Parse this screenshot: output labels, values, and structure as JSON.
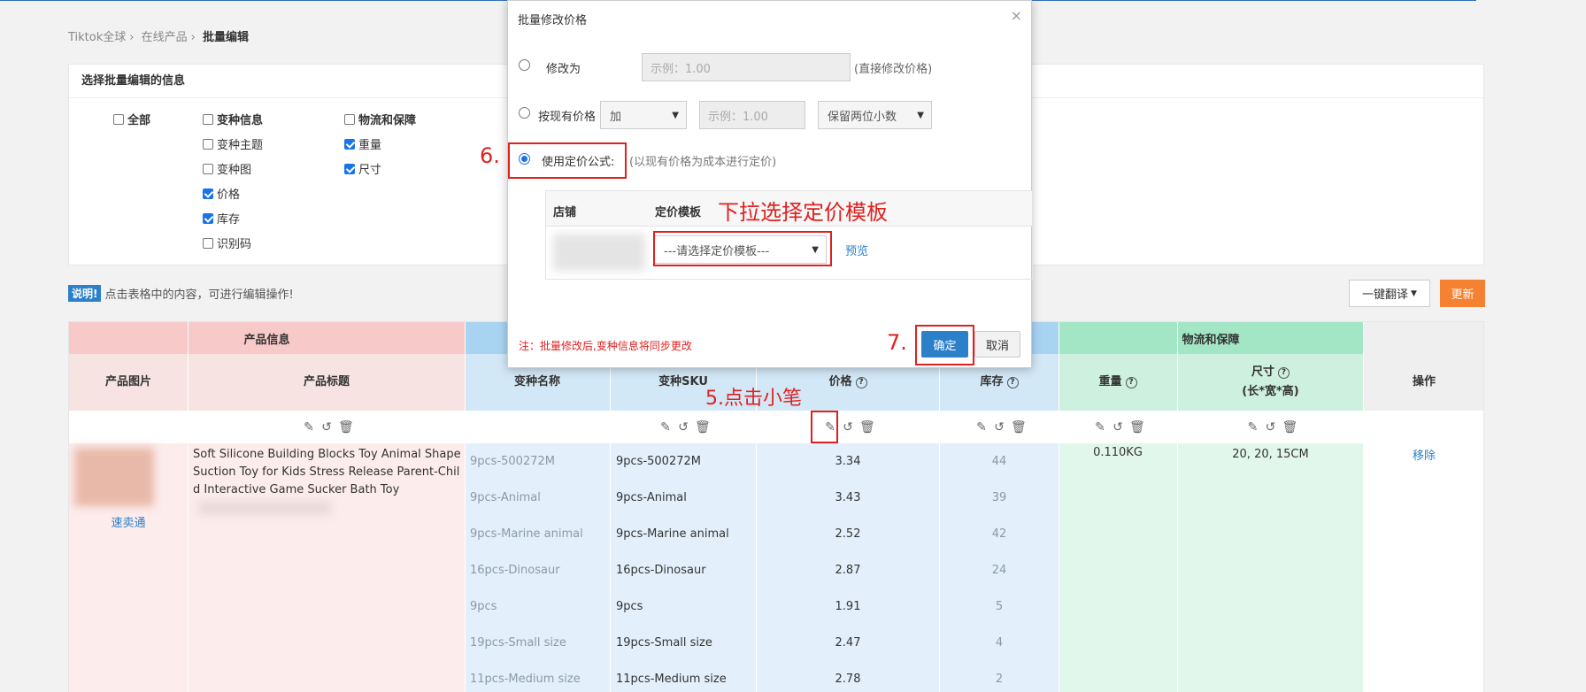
{
  "breadcrumb": [
    "Tiktok全球",
    "在线产品",
    "批量编辑"
  ],
  "select_panel": {
    "title": "选择批量编辑的信息",
    "checkboxes": [
      {
        "label": "全部",
        "checked": false,
        "bold": true
      },
      {
        "label": "变种信息",
        "checked": false,
        "bold": true
      },
      {
        "label": "变种主题",
        "checked": false
      },
      {
        "label": "变种图",
        "checked": false
      },
      {
        "label": "价格",
        "checked": true
      },
      {
        "label": "库存",
        "checked": true
      },
      {
        "label": "识别码",
        "checked": false
      },
      {
        "label": "物流和保障",
        "checked": false,
        "bold": true
      },
      {
        "label": "重量",
        "checked": true
      },
      {
        "label": "尺寸",
        "checked": true
      }
    ]
  },
  "notice": {
    "tag": "说明!",
    "text": "点击表格中的内容，可进行编辑操作!"
  },
  "toolbar": {
    "translate": "一键翻译",
    "update": "更新"
  },
  "table": {
    "groups": {
      "product": "产品信息",
      "logistics": "物流和保障"
    },
    "headers": {
      "image": "产品图片",
      "title": "产品标题",
      "variant": "变种名称",
      "sku": "变种SKU",
      "price": "价格",
      "stock": "库存",
      "weight": "重量",
      "size": "尺寸",
      "size_sub": "(长*宽*高)",
      "action": "操作"
    },
    "product": {
      "title": "Soft Silicone Building Blocks Toy Animal Shape Suction Toy for Kids Stress Release Parent-Child Interactive Game Sucker Bath Toy",
      "store_link": "速卖通",
      "weight": "0.110KG",
      "size": "20, 20, 15CM",
      "remove": "移除"
    },
    "rows": [
      {
        "variant": "9pcs-500272M",
        "sku": "9pcs-500272M",
        "price": "3.34",
        "stock": "44"
      },
      {
        "variant": "9pcs-Animal",
        "sku": "9pcs-Animal",
        "price": "3.43",
        "stock": "39"
      },
      {
        "variant": "9pcs-Marine animal",
        "sku": "9pcs-Marine animal",
        "price": "2.52",
        "stock": "42"
      },
      {
        "variant": "16pcs-Dinosaur",
        "sku": "16pcs-Dinosaur",
        "price": "2.87",
        "stock": "24"
      },
      {
        "variant": "9pcs",
        "sku": "9pcs",
        "price": "1.91",
        "stock": "5"
      },
      {
        "variant": "19pcs-Small size",
        "sku": "19pcs-Small size",
        "price": "2.47",
        "stock": "4"
      },
      {
        "variant": "11pcs-Medium size",
        "sku": "11pcs-Medium size",
        "price": "2.78",
        "stock": "2"
      }
    ]
  },
  "modal": {
    "title": "批量修改价格",
    "opt1_label": "修改为",
    "opt1_placeholder": "示例：1.00",
    "opt1_hint": "(直接修改价格)",
    "opt2_label": "按现有价格",
    "opt2_op": "加",
    "opt2_placeholder": "示例：1.00",
    "opt2_round": "保留两位小数",
    "opt3_label": "使用定价公式:",
    "opt3_hint": "(以现有价格为成本进行定价)",
    "store_col": "店铺",
    "template_col": "定价模板",
    "template_select": "---请选择定价模板---",
    "preview": "预览",
    "footer_note": "注：批量修改后,变种信息将同步更改",
    "ok": "确定",
    "cancel": "取消"
  },
  "annotations": {
    "step6": "6.",
    "step7": "7.",
    "step5": "5.点击小笔",
    "dropdown_hint": "下拉选择定价模板"
  },
  "colors": {
    "product_bg": "#fdecec",
    "product_header": "#f8c9c9",
    "variant_bg": "#e3f0fb",
    "variant_header": "#a8d4f2",
    "logistics_bg": "#e1f7ec",
    "logistics_header": "#a3e6c6",
    "accent_blue": "#2b80c9",
    "update_orange": "#f58232",
    "annotation_red": "#e02020"
  }
}
